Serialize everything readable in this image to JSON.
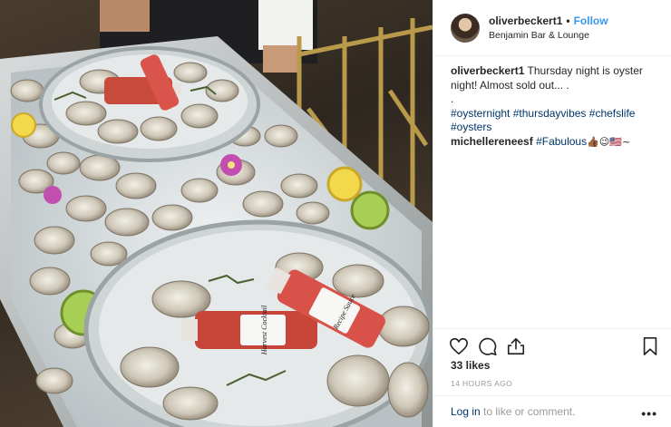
{
  "post": {
    "author": "oliverbeckert1",
    "separator": "•",
    "follow_label": "Follow",
    "location": "Benjamin Bar & Lounge"
  },
  "caption": {
    "user": "oliverbeckert1",
    "text": "Thursday night is oyster night! Almost sold out... .",
    "dot_line": ".",
    "hashtags": [
      "#oysternight",
      "#thursdayvibes",
      "#chefslife",
      "#oysters"
    ]
  },
  "comment": {
    "user": "michellereneesf",
    "text": "#Fabulous",
    "emojis": "👍🏾😉🇺🇸~"
  },
  "photo": {
    "bottle_labels": [
      "Harvest Cocktail",
      "Recipe Sauce"
    ]
  },
  "actions": {
    "like_icon": "heart-icon",
    "comment_icon": "comment-icon",
    "share_icon": "share-icon",
    "save_icon": "bookmark-icon"
  },
  "stats": {
    "likes": "33 likes",
    "time": "14 HOURS AGO"
  },
  "footer": {
    "login_label": "Log in",
    "rest": " to like or comment.",
    "more_label": "•••"
  },
  "colors": {
    "accent": "#3897f0",
    "link": "#003569",
    "muted": "#999999"
  }
}
